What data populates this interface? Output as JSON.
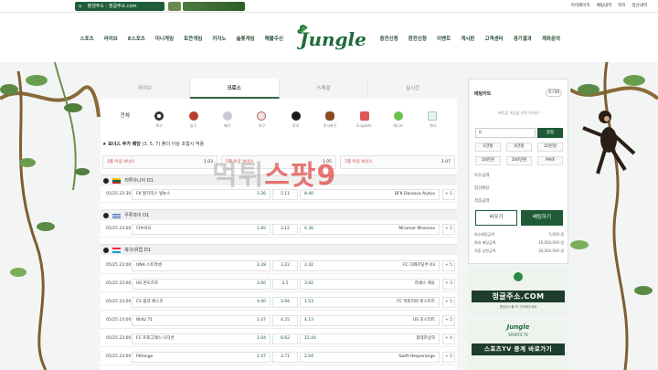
{
  "topbar": {
    "address_label": "평생주소 : 정글주소.com",
    "links": [
      "마이페이지",
      "배팅내역",
      "쪽지",
      "정산내역"
    ]
  },
  "brand": {
    "logo": "Jungle"
  },
  "nav": {
    "left": [
      "스포츠",
      "라이브",
      "E스포츠",
      "미니게임",
      "토큰게임",
      "카지노",
      "슬롯게임",
      "해볼주신"
    ],
    "right": [
      "충전신청",
      "환전신청",
      "이벤트",
      "게시판",
      "고객센터",
      "경기결과",
      "계좌문의"
    ]
  },
  "tabs": [
    {
      "label": "라이브",
      "active": false
    },
    {
      "label": "크로스",
      "active": true
    },
    {
      "label": "스페셜",
      "active": false
    },
    {
      "label": "실시간",
      "active": false
    }
  ],
  "sports": [
    {
      "label": "전체",
      "color": ""
    },
    {
      "label": "축구",
      "color": "#333333"
    },
    {
      "label": "농구",
      "color": "#b5402c"
    },
    {
      "label": "배구",
      "color": "#c9c9d6"
    },
    {
      "label": "야구",
      "color": "#e6e6e6"
    },
    {
      "label": "하키",
      "color": "#1a1a1a"
    },
    {
      "label": "미식축구",
      "color": "#8a4a25"
    },
    {
      "label": "E-sports",
      "color": "#e05555"
    },
    {
      "label": "테니스",
      "color": "#6cc24a"
    },
    {
      "label": "기타",
      "color": "#b0d9b6"
    }
  ],
  "bonus": {
    "title": "★ 보너스 추가 배당",
    "subtitle": "(3, 5, 7) 폴더 이상 조합시 적용",
    "items": [
      {
        "label": "3폴 이상 보너스",
        "value": "1.03"
      },
      {
        "label": "5폴 이상 보너스",
        "value": "1.05"
      },
      {
        "label": "7폴 이상 보너스",
        "value": "1.07"
      }
    ]
  },
  "matches": [
    {
      "league": "리투아니아 D1",
      "time": "05/25 22:30",
      "home": "FK 잘기리스 빌뉴스",
      "h": "1.26",
      "d": "5.11",
      "a": "8.40",
      "away": "DFK Dainava Alytus",
      "more": "+ 5"
    },
    {
      "league": "우루과이 D1",
      "time": "05/25 23:00",
      "home": "다누비오",
      "h": "1.85",
      "d": "3.12",
      "a": "4.36",
      "away": "Miramar Misiones",
      "more": "+ 5"
    },
    {
      "league": "축구/유럽 D1",
      "time": "05/25 23:00",
      "home": "UNA 스트라센",
      "h": "2.28",
      "d": "3.22",
      "a": "2.42",
      "away": "FC 디페르당주 03",
      "more": "+ 5"
    },
    {
      "league": "",
      "time": "05/25 23:00",
      "home": "US 몬도르프",
      "h": "1.60",
      "d": "3.5",
      "a": "3.92",
      "away": "라세스 에슈",
      "more": "+ 3"
    },
    {
      "league": "",
      "time": "05/25 23:00",
      "home": "CS 플라 에스츠",
      "h": "4.00",
      "d": "3.94",
      "a": "1.53",
      "away": "FC 빅토리아 로스트트",
      "more": "+ 5"
    },
    {
      "league": "",
      "time": "05/25 23:00",
      "home": "Wiltz 71",
      "h": "1.47",
      "d": "4.25",
      "a": "4.13",
      "away": "US 호스티트",
      "more": "+ 5"
    },
    {
      "league": "",
      "time": "05/25 23:00",
      "home": "FC 프로그레스 니더콘",
      "h": "1.04",
      "d": "8.62",
      "a": "15.44",
      "away": "몽데르상하",
      "more": "+ 4"
    },
    {
      "league": "",
      "time": "05/25 23:00",
      "home": "Pétange",
      "h": "2.47",
      "d": "3.71",
      "a": "2.04",
      "away": "Swift Hesperange",
      "more": "+ 5"
    }
  ],
  "betslip": {
    "title": "베팅카트",
    "reset": "초기화",
    "hint": "배팅할 게임을 선택 하세요!",
    "amount": "0",
    "apply": "정정",
    "quick": [
      "1만원",
      "5만원",
      "10만원",
      "50만원",
      "100만원",
      "MAX"
    ],
    "info": [
      "보유금액",
      "합산배당",
      "적중금액"
    ],
    "clear_btn": "비우기",
    "bet_btn": "배팅하기",
    "limits": [
      {
        "label": "최소배팅금액",
        "value": "5,000 원"
      },
      {
        "label": "최대 배팅금액",
        "value": "10,000,000 원"
      },
      {
        "label": "적중 상한금액",
        "value": "30,000,000 원"
      }
    ]
  },
  "banners": [
    {
      "big": "정글주소.COM",
      "sub": "평생주소를 꼭 기억해주세요"
    },
    {
      "big": "스포츠TV 중계 바로가기",
      "tag": "SPORTS TV"
    }
  ],
  "watermark": {
    "part1": "먹튀",
    "part2": "스팟9"
  },
  "colors": {
    "primary": "#1e5a36",
    "accent_red": "#c43a2b"
  }
}
